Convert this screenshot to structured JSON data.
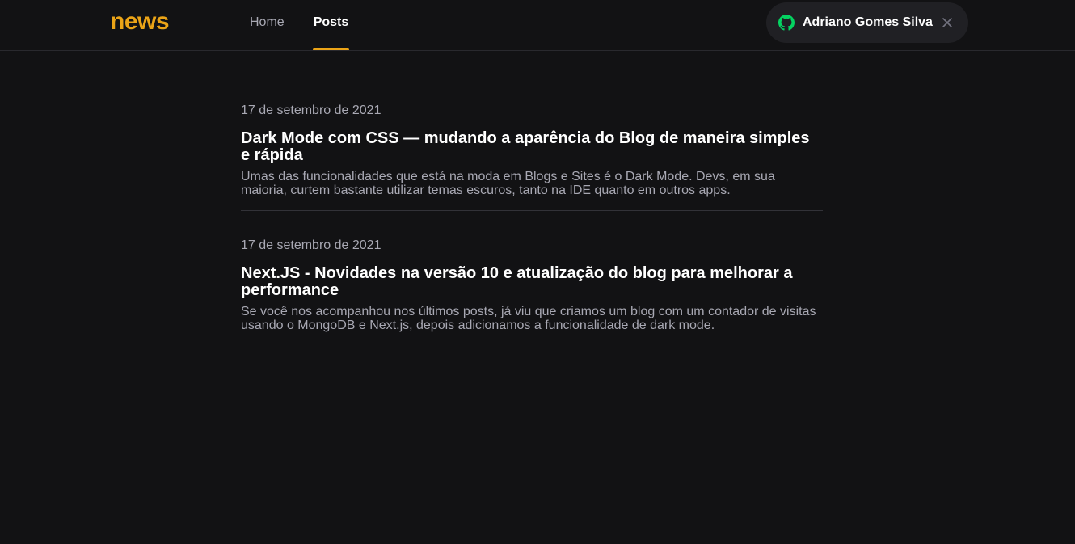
{
  "header": {
    "logo": "news",
    "nav": [
      {
        "label": "Home",
        "active": false
      },
      {
        "label": "Posts",
        "active": true
      }
    ],
    "user": {
      "name": "Adriano Gomes Silva",
      "icon": "github-icon",
      "icon_color": "#04d361"
    }
  },
  "posts": [
    {
      "date": "17 de setembro de 2021",
      "title": "Dark Mode com CSS — mudando a aparência do Blog de maneira simples e rápida",
      "excerpt": "Umas das funcionalidades que está na moda em Blogs e Sites é o Dark Mode. Devs, em sua maioria, curtem bastante utilizar temas escuros, tanto na IDE quanto em outros apps."
    },
    {
      "date": "17 de setembro de 2021",
      "title": "Next.JS - Novidades na versão 10 e atualização do blog para melhorar a performance",
      "excerpt": "Se você nos acompanhou nos últimos posts, já viu que criamos um blog com um contador de visitas usando o MongoDB e Next.js, depois adicionamos a funcionalidade de dark mode."
    }
  ],
  "colors": {
    "background": "#121214",
    "accent": "#eba417",
    "text": "#ffffff",
    "muted": "#a8a8b3"
  }
}
